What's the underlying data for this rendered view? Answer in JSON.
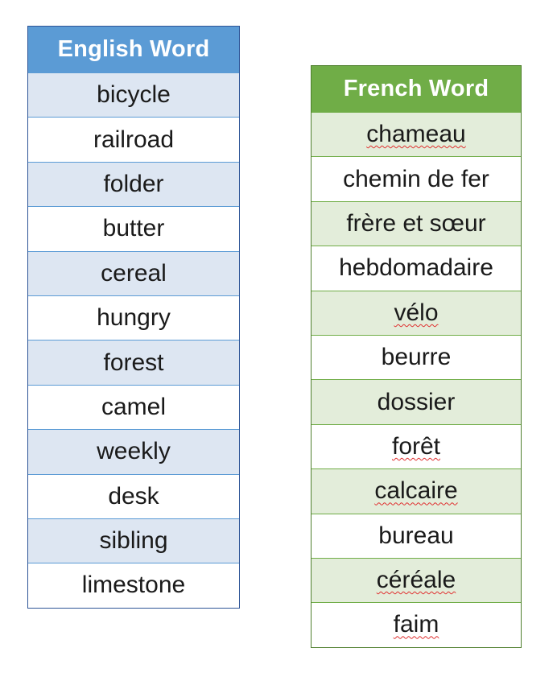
{
  "english_table": {
    "header": "English Word",
    "words": [
      "bicycle",
      "railroad",
      "folder",
      "butter",
      "cereal",
      "hungry",
      "forest",
      "camel",
      "weekly",
      "desk",
      "sibling",
      "limestone"
    ]
  },
  "french_table": {
    "header": "French Word",
    "words": [
      "chameau",
      "chemin de fer",
      "frère et sœur",
      "hebdomadaire",
      "vélo",
      "beurre",
      "dossier",
      "forêt",
      "calcaire",
      "bureau",
      "céréale",
      "faim"
    ]
  },
  "colors": {
    "english_header": "#5b9bd5",
    "english_border": "#2e5597",
    "english_band": "#dde6f2",
    "french_header": "#70ad47",
    "french_border": "#4f7f2e",
    "french_band": "#e3edda"
  }
}
